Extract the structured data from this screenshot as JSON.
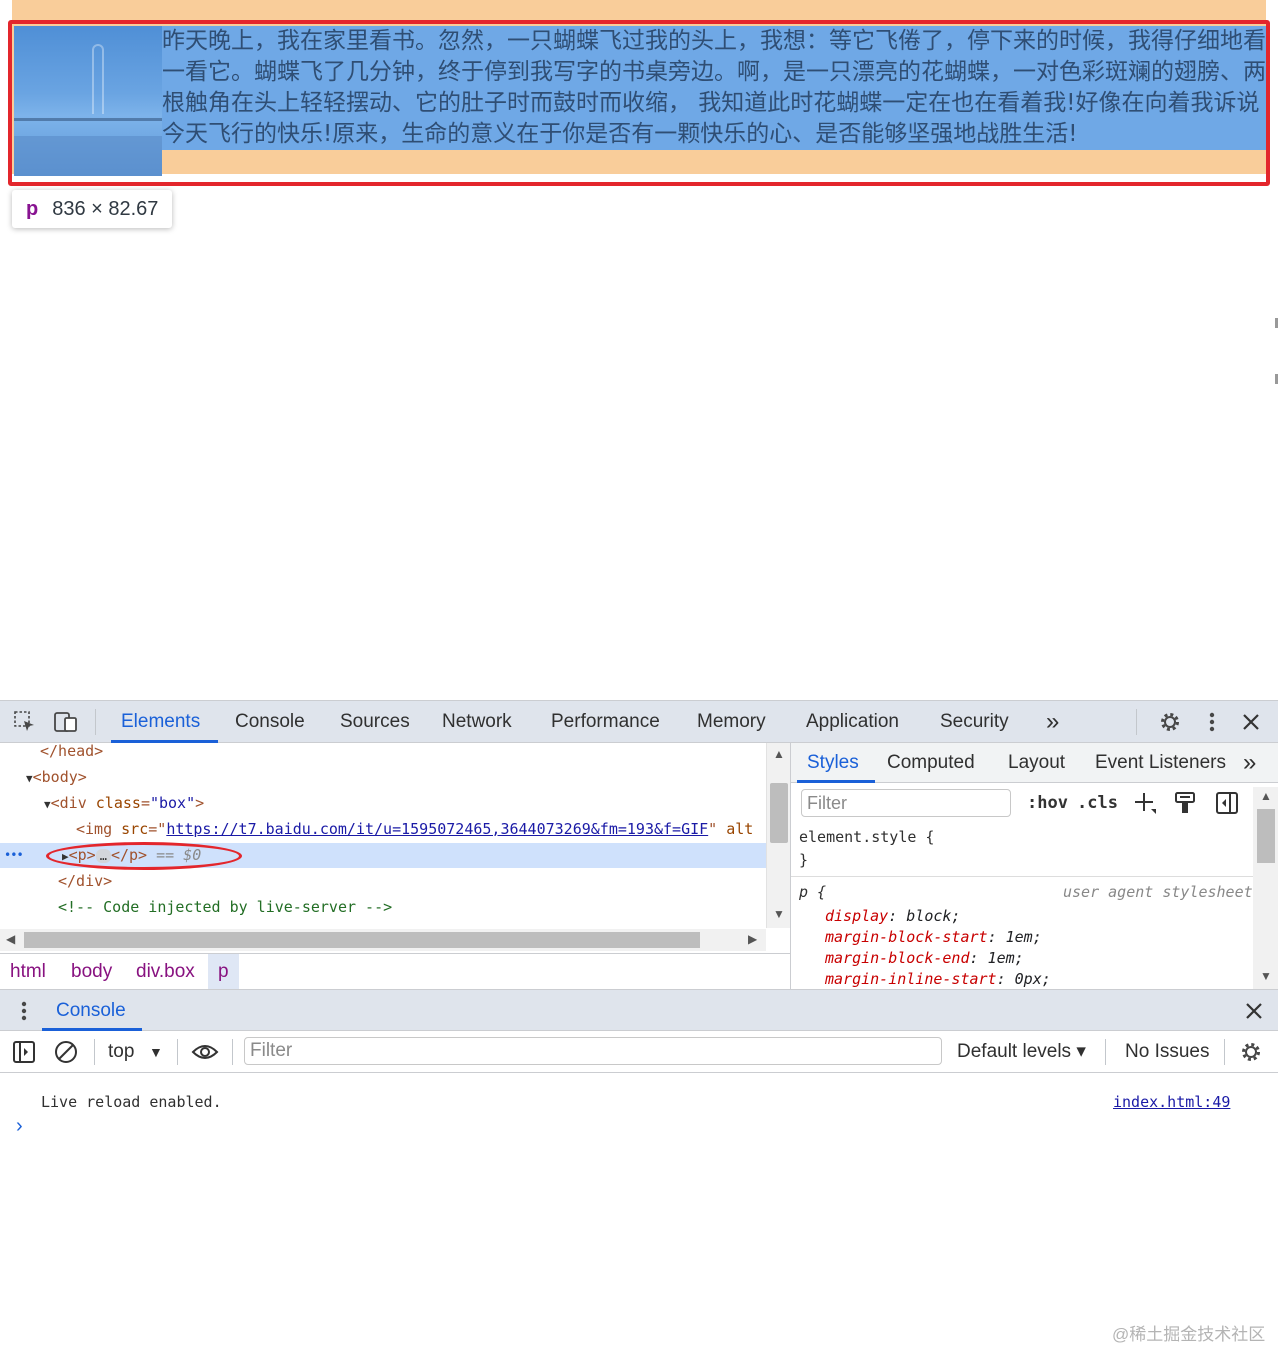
{
  "viewport": {
    "paragraph_text": "昨天晚上，我在家里看书。忽然，一只蝴蝶飞过我的头上，我想：等它飞倦了，停下来的时候，我得仔细地看一看它。蝴蝶飞了几分钟，终于停到我写字的书桌旁边。啊，是一只漂亮的花蝴蝶，一对色彩斑斓的翅膀、两根触角在头上轻轻摆动、它的肚子时而鼓时而收缩， 我知道此时花蝴蝶一定在也在看着我!好像在向着我诉说今天飞行的快乐!原来，生命的意义在于你是否有一颗快乐的心、是否能够坚强地战胜生活!",
    "tooltip": {
      "tag": "p",
      "dims": "836 × 82.67"
    }
  },
  "devtools": {
    "tabs": [
      "Elements",
      "Console",
      "Sources",
      "Network",
      "Performance",
      "Memory",
      "Application",
      "Security"
    ],
    "more_tabs": "»",
    "active_tab": "Elements",
    "icons": {
      "inspect": "inspect-icon",
      "device": "device-toggle-icon",
      "settings": "gear-icon",
      "menu": "kebab-menu-icon",
      "close": "close-icon"
    },
    "tree": {
      "head_close": "</head>",
      "body_open": "<body>",
      "div_open_tag": "<div",
      "div_attr_name": "class",
      "div_attr_value": "\"box\"",
      "div_open_end": ">",
      "img_tag": "<img",
      "img_attr_name": "src",
      "img_src": "https://t7.baidu.com/it/u=1595072465,3644073269&fm=193&f=GIF",
      "img_alt": "alt",
      "p_open": "<p>",
      "p_ellipsis": "…",
      "p_close": "</p>",
      "p_selected_marker": "== $0",
      "div_close": "</div>",
      "comment": "<!-- Code injected by live-server -->",
      "row_dots": "•••"
    },
    "breadcrumbs": [
      "html",
      "body",
      "div.box",
      "p"
    ],
    "styles": {
      "tabs": [
        "Styles",
        "Computed",
        "Layout",
        "Event Listeners"
      ],
      "more": "»",
      "filter_placeholder": "Filter",
      "hov": ":hov",
      "cls": ".cls",
      "element_style_open": "element.style {",
      "element_style_close": "}",
      "rule_selector": "p {",
      "rule_source": "user agent stylesheet",
      "declarations": [
        {
          "prop": "display",
          "value": "block;"
        },
        {
          "prop": "margin-block-start",
          "value": "1em;"
        },
        {
          "prop": "margin-block-end",
          "value": "1em;"
        },
        {
          "prop": "margin-inline-start",
          "value": "0px;"
        }
      ]
    },
    "console": {
      "tab": "Console",
      "context": "top",
      "filter_placeholder": "Filter",
      "levels": "Default levels ▾",
      "issues": "No Issues",
      "message": "Live reload enabled.",
      "message_source": "index.html:49",
      "prompt": "›"
    }
  },
  "watermark": "@稀土掘金技术社区",
  "colors": {
    "box_bg": "#f9cd9a",
    "highlight_blue": "#6fa8e6",
    "outline_red": "#e3262c",
    "accent_blue": "#1a60d8"
  }
}
